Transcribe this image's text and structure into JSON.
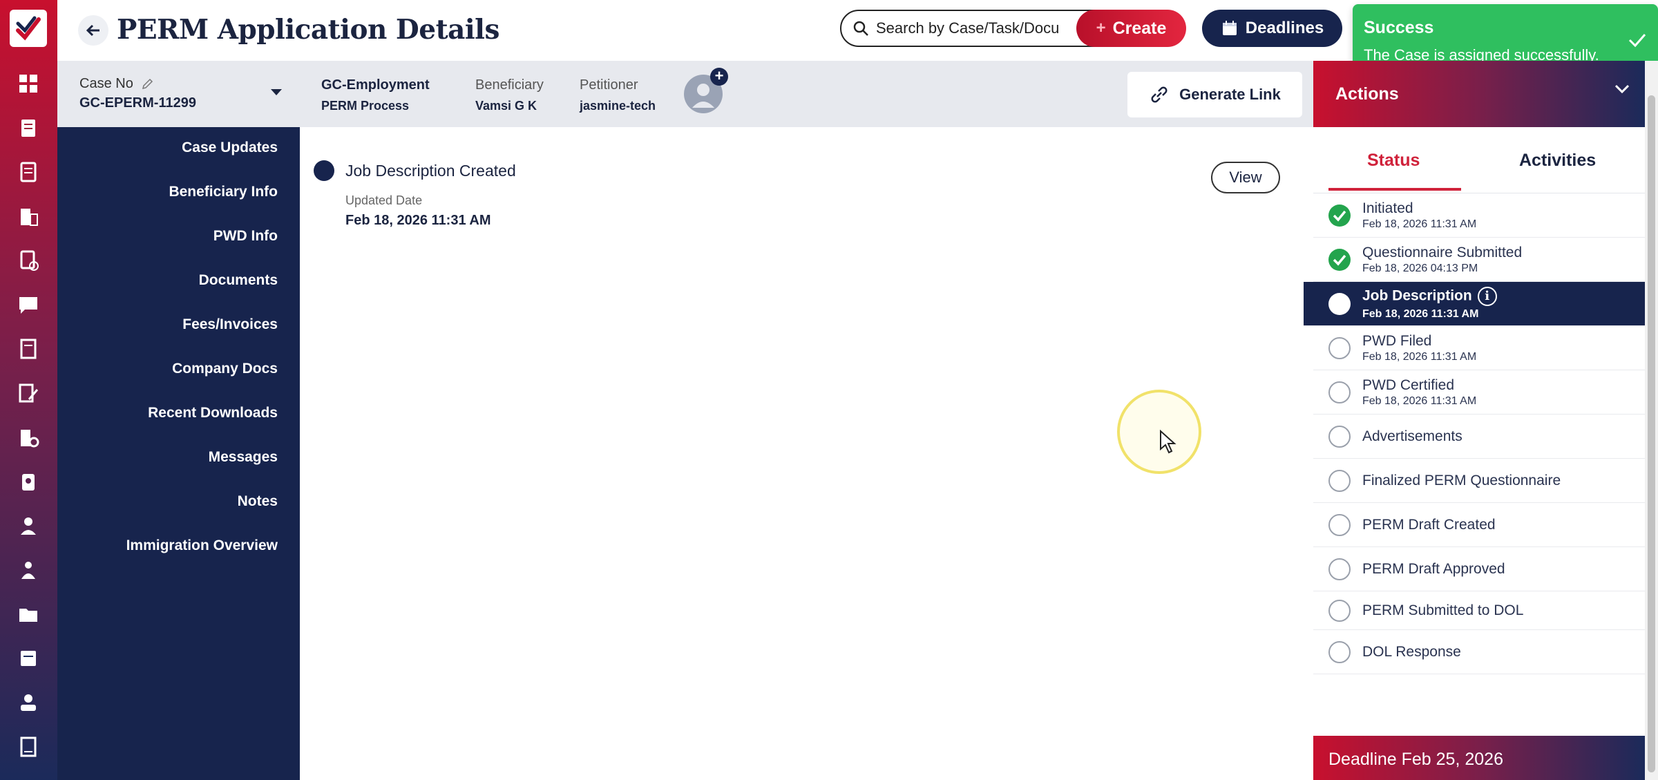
{
  "header": {
    "title": "PERM Application Details",
    "search_placeholder": "Search by Case/Task/Docu",
    "create_label": "Create",
    "deadlines_label": "Deadlines"
  },
  "toast": {
    "title": "Success",
    "message": "The Case is assigned successfully."
  },
  "case_info": {
    "case_no_label": "Case No",
    "case_no": "GC-EPERM-11299",
    "type": "GC-Employment",
    "process": "PERM Process",
    "beneficiary_label": "Beneficiary",
    "beneficiary": "Vamsi G K",
    "petitioner_label": "Petitioner",
    "petitioner": "jasmine-tech",
    "generate_link_label": "Generate Link"
  },
  "nav": {
    "items": [
      {
        "label": "Case Updates"
      },
      {
        "label": "Beneficiary Info"
      },
      {
        "label": "PWD Info"
      },
      {
        "label": "Documents"
      },
      {
        "label": "Fees/Invoices"
      },
      {
        "label": "Company Docs"
      },
      {
        "label": "Recent Downloads"
      },
      {
        "label": "Messages"
      },
      {
        "label": "Notes"
      },
      {
        "label": "Immigration Overview"
      }
    ]
  },
  "main": {
    "event_title": "Job Description Created",
    "updated_label": "Updated Date",
    "updated_value": "Feb 18, 2026 11:31 AM",
    "view_label": "View"
  },
  "actions": {
    "title": "Actions",
    "tabs": [
      {
        "label": "Status"
      },
      {
        "label": "Activities"
      }
    ],
    "active_tab": "Status",
    "statuses": [
      {
        "label": "Initiated",
        "date": "Feb 18, 2026 11:31 AM",
        "state": "done"
      },
      {
        "label": "Questionnaire Submitted",
        "date": "Feb 18, 2026 04:13 PM",
        "state": "done"
      },
      {
        "label": "Job Description",
        "date": "Feb 18, 2026 11:31 AM",
        "state": "active"
      },
      {
        "label": "PWD Filed",
        "date": "Feb 18, 2026 11:31 AM",
        "state": "pending"
      },
      {
        "label": "PWD Certified",
        "date": "Feb 18, 2026 11:31 AM",
        "state": "pending"
      },
      {
        "label": "Advertisements",
        "date": "",
        "state": "pending"
      },
      {
        "label": "Finalized PERM Questionnaire",
        "date": "",
        "state": "pending"
      },
      {
        "label": "PERM Draft Created",
        "date": "",
        "state": "pending"
      },
      {
        "label": "PERM Draft Approved",
        "date": "",
        "state": "pending"
      },
      {
        "label": "PERM Submitted to DOL",
        "date": "",
        "state": "pending"
      },
      {
        "label": "DOL Response",
        "date": "",
        "state": "pending"
      }
    ],
    "deadline": "Deadline Feb 25, 2026"
  },
  "rail": {
    "icons": [
      "dashboard-icon",
      "clipboard-icon",
      "document-list-icon",
      "building-icon",
      "document-check-icon",
      "chat-icon",
      "ledger-icon",
      "edit-document-icon",
      "building-gear-icon",
      "badge-icon",
      "user-icon",
      "users-icon",
      "folder-icon",
      "note-icon",
      "person-card-icon",
      "report-icon"
    ]
  },
  "colors": {
    "navy": "#17244d",
    "brand_red": "#c8102e",
    "success_green": "#2fbf5f",
    "status_done": "#23a44d",
    "status_tab": "#d0223b"
  }
}
